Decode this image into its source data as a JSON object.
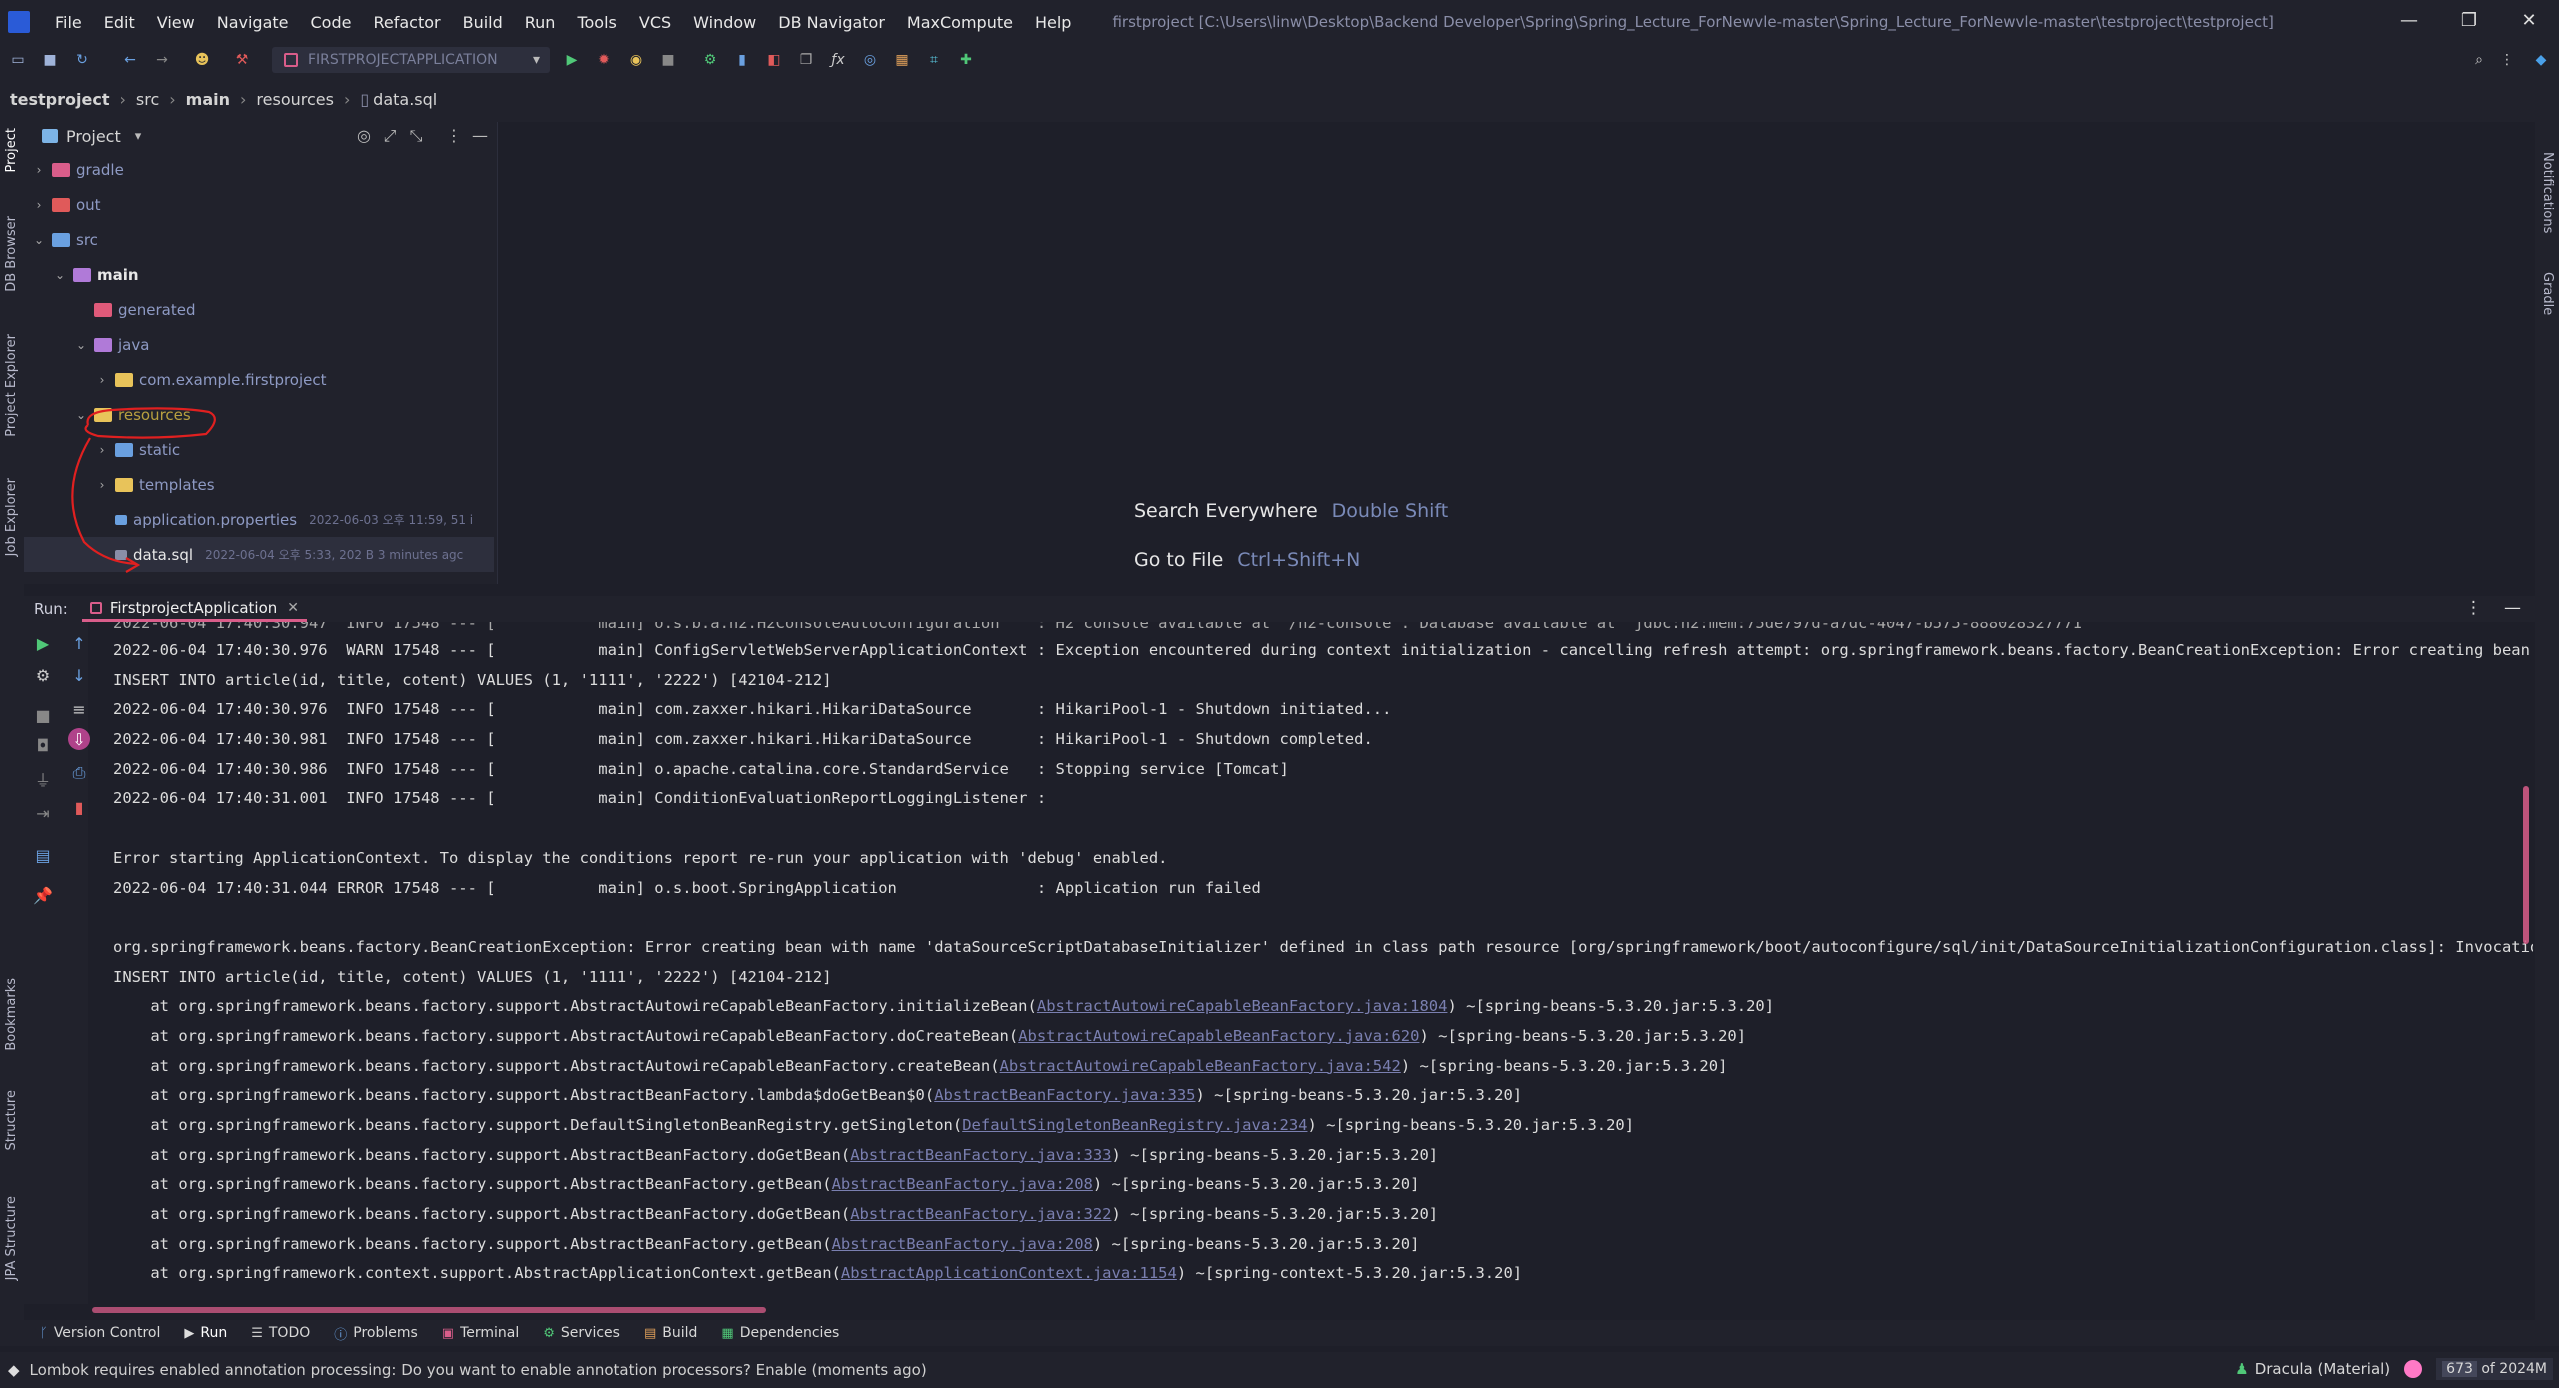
{
  "menu": {
    "items": [
      "File",
      "Edit",
      "View",
      "Navigate",
      "Code",
      "Refactor",
      "Build",
      "Run",
      "Tools",
      "VCS",
      "Window",
      "DB Navigator",
      "MaxCompute",
      "Help"
    ],
    "window_title": "firstproject [C:\\Users\\linw\\Desktop\\Backend Developer\\Spring\\Spring_Lecture_ForNewvle-master\\Spring_Lecture_ForNewvle-master\\testproject\\testproject]",
    "minimize": "—",
    "restore": "❐",
    "close": "✕"
  },
  "toolbar": {
    "run_config": "FIRSTPROJECTAPPLICATION"
  },
  "breadcrumb": {
    "project": "testproject",
    "src": "src",
    "main": "main",
    "resources": "resources",
    "file": "data.sql"
  },
  "left_strip": {
    "project": "Project",
    "db_browser": "DB Browser",
    "project_explorer": "Project Explorer",
    "job_explorer": "Job Explorer",
    "bookmarks": "Bookmarks",
    "structure": "Structure",
    "jpa_structure": "JPA Structure"
  },
  "right_strip": {
    "notifications": "Notifications",
    "gradle": "Gradle"
  },
  "project_panel": {
    "title": "Project",
    "tree": [
      {
        "name": "gradle",
        "level": 1,
        "arrow": "›",
        "color": "#d95d8a"
      },
      {
        "name": "out",
        "level": 1,
        "arrow": "›",
        "color": "#e05a5a"
      },
      {
        "name": "src",
        "level": 1,
        "arrow": "⌄",
        "color": "#6aa0e0"
      },
      {
        "name": "main",
        "level": 2,
        "arrow": "⌄",
        "color": "#b07ad8"
      },
      {
        "name": "generated",
        "level": 3,
        "arrow": "",
        "color": "#e05a7a"
      },
      {
        "name": "java",
        "level": 3,
        "arrow": "⌄",
        "color": "#b07ad8"
      },
      {
        "name": "com.example.firstproject",
        "level": 4,
        "arrow": "›",
        "color": "#e8c35a"
      },
      {
        "name": "resources",
        "level": 3,
        "arrow": "⌄",
        "color": "#e8c35a"
      },
      {
        "name": "static",
        "level": 4,
        "arrow": "›",
        "color": "#6aa0e0"
      },
      {
        "name": "templates",
        "level": 4,
        "arrow": "›",
        "color": "#e8c35a"
      },
      {
        "name": "application.properties",
        "level": 4,
        "arrow": "",
        "color": "#6aa0e0",
        "meta": "2022-06-03 오후 11:59, 51 i"
      },
      {
        "name": "data.sql",
        "level": 4,
        "arrow": "",
        "color": "#8a8ea8",
        "meta": "2022-06-04 오후 5:33, 202 B 3 minutes agc"
      }
    ]
  },
  "editor": {
    "search_everywhere": "Search Everywhere",
    "search_key": "Double Shift",
    "goto_file": "Go to File",
    "goto_key": "Ctrl+Shift+N"
  },
  "run_panel": {
    "label": "Run:",
    "tab": "FirstprojectApplication",
    "lines": [
      {
        "pre": "2022-06-04 17:40:30.976  WARN 17548 --- [           main] ConfigServletWebServerApplicationContext : Exception encountered during context initialization - cancelling refresh attempt: org.springframework.beans.factory.BeanCreationException: Error creating bean with nam"
      },
      {
        "pre": "INSERT INTO article(id, title, cotent) VALUES (1, '1111', '2222') [42104-212]"
      },
      {
        "pre": "2022-06-04 17:40:30.976  INFO 17548 --- [           main] com.zaxxer.hikari.HikariDataSource       : HikariPool-1 - Shutdown initiated..."
      },
      {
        "pre": "2022-06-04 17:40:30.981  INFO 17548 --- [           main] com.zaxxer.hikari.HikariDataSource       : HikariPool-1 - Shutdown completed."
      },
      {
        "pre": "2022-06-04 17:40:30.986  INFO 17548 --- [           main] o.apache.catalina.core.StandardService   : Stopping service [Tomcat]"
      },
      {
        "pre": "2022-06-04 17:40:31.001  INFO 17548 --- [           main] ConditionEvaluationReportLoggingListener :"
      },
      {
        "pre": ""
      },
      {
        "pre": "Error starting ApplicationContext. To display the conditions report re-run your application with 'debug' enabled."
      },
      {
        "pre": "2022-06-04 17:40:31.044 ERROR 17548 --- [           main] o.s.boot.SpringApplication               : Application run failed"
      },
      {
        "pre": ""
      },
      {
        "pre": "org.springframework.beans.factory.BeanCreationException: Error creating bean with name 'dataSourceScriptDatabaseInitializer' defined in class path resource [org/springframework/boot/autoconfigure/sql/init/DataSourceInitializationConfiguration.class]: Invocation of ini"
      },
      {
        "pre": "INSERT INTO article(id, title, cotent) VALUES (1, '1111', '2222') [42104-212]"
      },
      {
        "pre": "    at org.springframework.beans.factory.support.AbstractAutowireCapableBeanFactory.initializeBean(",
        "link": "AbstractAutowireCapableBeanFactory.java:1804",
        "post": ") ~[spring-beans-5.3.20.jar:5.3.20]"
      },
      {
        "pre": "    at org.springframework.beans.factory.support.AbstractAutowireCapableBeanFactory.doCreateBean(",
        "link": "AbstractAutowireCapableBeanFactory.java:620",
        "post": ") ~[spring-beans-5.3.20.jar:5.3.20]"
      },
      {
        "pre": "    at org.springframework.beans.factory.support.AbstractAutowireCapableBeanFactory.createBean(",
        "link": "AbstractAutowireCapableBeanFactory.java:542",
        "post": ") ~[spring-beans-5.3.20.jar:5.3.20]"
      },
      {
        "pre": "    at org.springframework.beans.factory.support.AbstractBeanFactory.lambda$doGetBean$0(",
        "link": "AbstractBeanFactory.java:335",
        "post": ") ~[spring-beans-5.3.20.jar:5.3.20]"
      },
      {
        "pre": "    at org.springframework.beans.factory.support.DefaultSingletonBeanRegistry.getSingleton(",
        "link": "DefaultSingletonBeanRegistry.java:234",
        "post": ") ~[spring-beans-5.3.20.jar:5.3.20]"
      },
      {
        "pre": "    at org.springframework.beans.factory.support.AbstractBeanFactory.doGetBean(",
        "link": "AbstractBeanFactory.java:333",
        "post": ") ~[spring-beans-5.3.20.jar:5.3.20]"
      },
      {
        "pre": "    at org.springframework.beans.factory.support.AbstractBeanFactory.getBean(",
        "link": "AbstractBeanFactory.java:208",
        "post": ") ~[spring-beans-5.3.20.jar:5.3.20]"
      },
      {
        "pre": "    at org.springframework.beans.factory.support.AbstractBeanFactory.doGetBean(",
        "link": "AbstractBeanFactory.java:322",
        "post": ") ~[spring-beans-5.3.20.jar:5.3.20]"
      },
      {
        "pre": "    at org.springframework.beans.factory.support.AbstractBeanFactory.getBean(",
        "link": "AbstractBeanFactory.java:208",
        "post": ") ~[spring-beans-5.3.20.jar:5.3.20]"
      },
      {
        "pre": "    at org.springframework.context.support.AbstractApplicationContext.getBean(",
        "link": "AbstractApplicationContext.java:1154",
        "post": ") ~[spring-context-5.3.20.jar:5.3.20]"
      }
    ]
  },
  "bottom_tabs": [
    "Version Control",
    "Run",
    "TODO",
    "Problems",
    "Terminal",
    "Services",
    "Build",
    "Dependencies"
  ],
  "status": {
    "message": "Lombok requires enabled annotation processing: Do you want to enable annotation processors? Enable (moments ago)",
    "theme": "Dracula (Material)",
    "memory_used": "673",
    "memory_total": "of 2024M"
  },
  "colors": {
    "accent": "#d95d8a",
    "background": "#1e1f29",
    "panel": "#21222c",
    "link": "#7a7fb0"
  }
}
